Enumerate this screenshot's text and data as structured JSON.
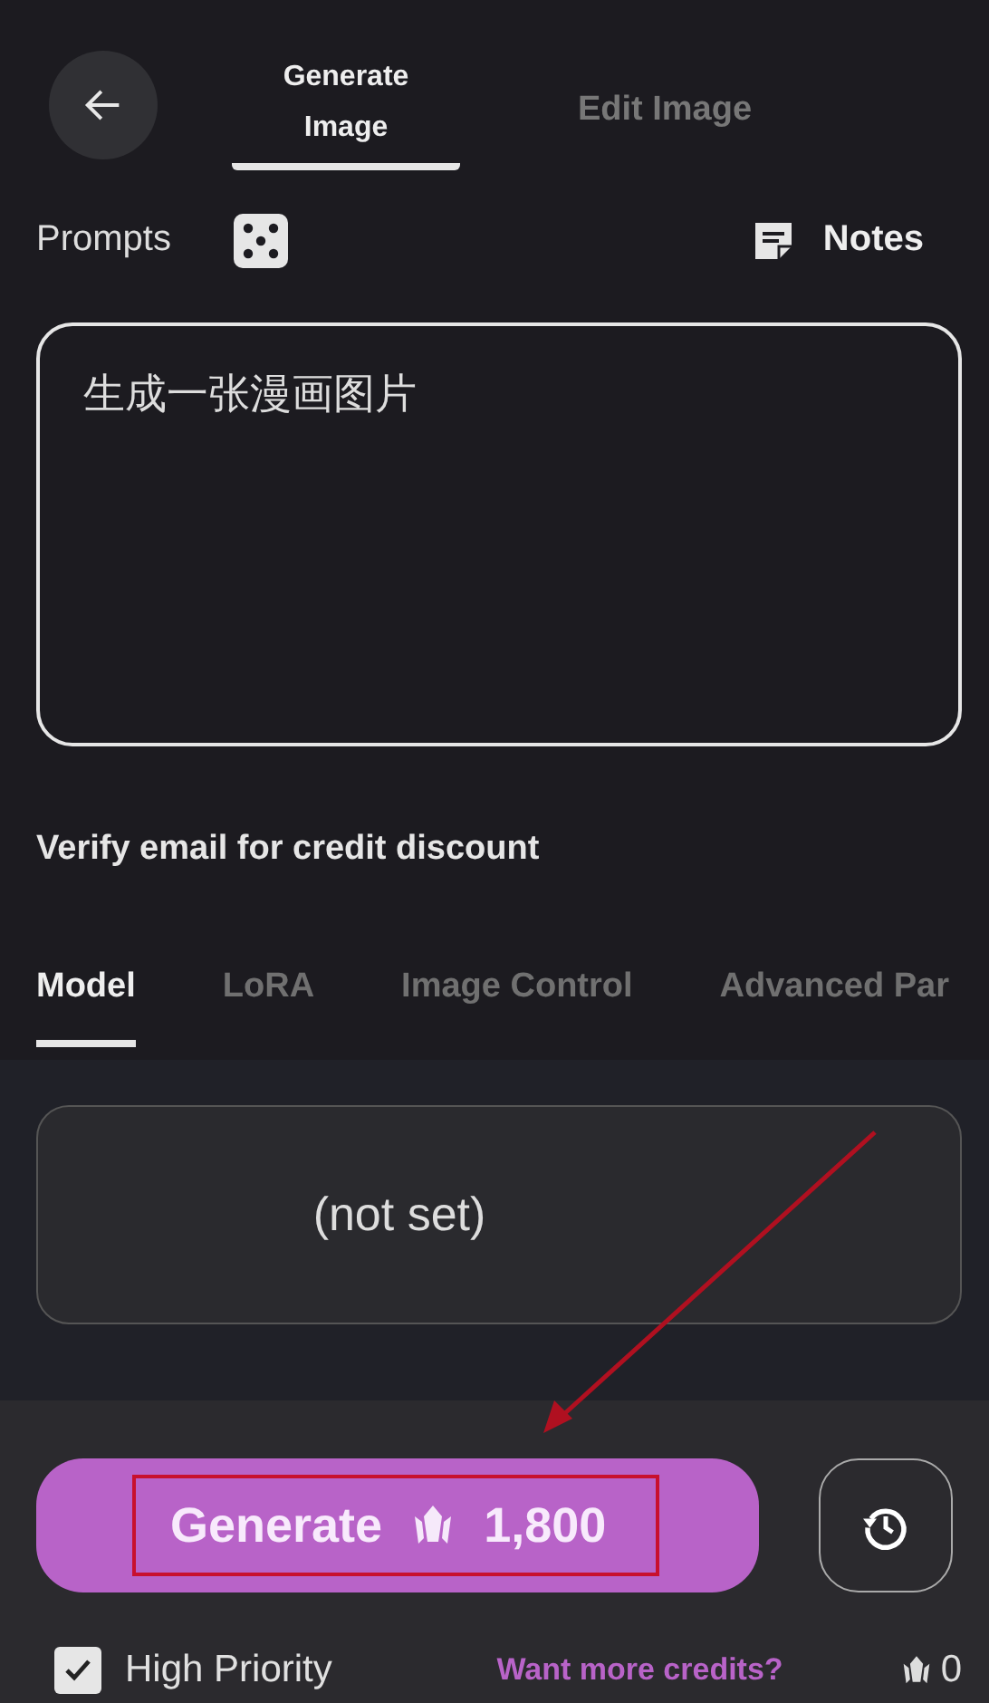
{
  "top_tabs": [
    {
      "label": "Generate\nImage",
      "selected": true
    },
    {
      "label": "Edit Image",
      "selected": false
    }
  ],
  "prompts": {
    "label": "Prompts",
    "notes_label": "Notes",
    "value": "生成一张漫画图片"
  },
  "verify_text": "Verify email for credit discount",
  "model_tabs": [
    {
      "label": "Model",
      "selected": true
    },
    {
      "label": "LoRA",
      "selected": false
    },
    {
      "label": "Image Control",
      "selected": false
    },
    {
      "label": "Advanced Par",
      "selected": false
    }
  ],
  "model_value": "(not set)",
  "generate": {
    "label": "Generate",
    "cost": "1,800"
  },
  "high_priority": {
    "label": "High Priority",
    "checked": true
  },
  "credits_link": "Want more credits?",
  "credits_balance": "0"
}
